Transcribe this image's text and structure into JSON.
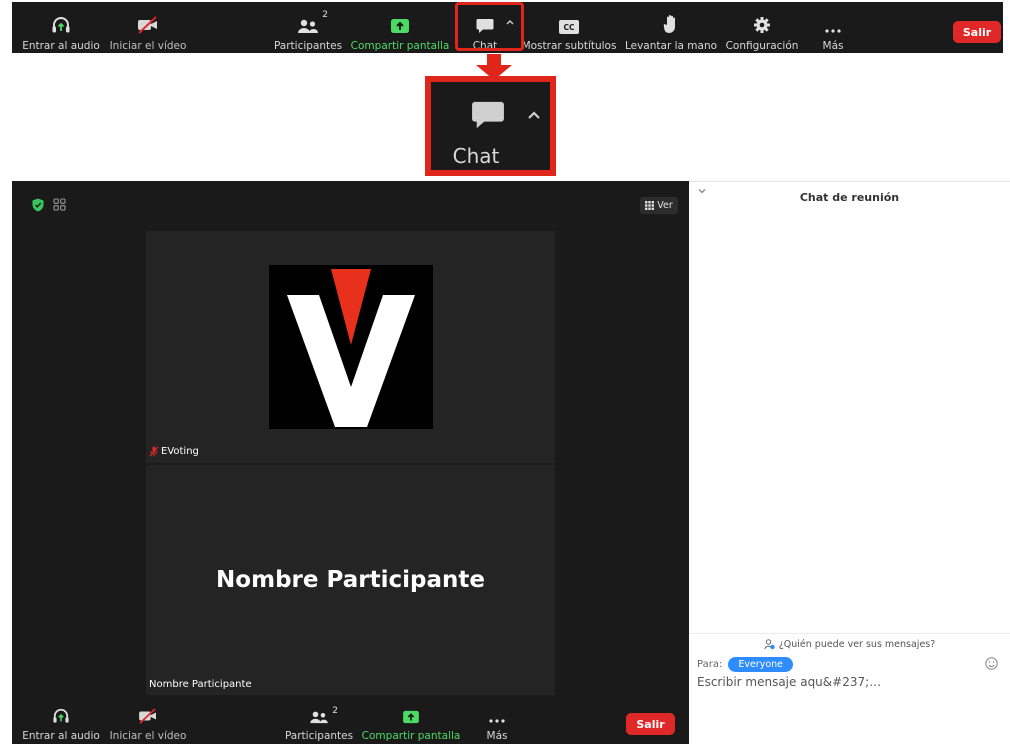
{
  "toolbar": {
    "audio_label": "Entrar al audio",
    "video_label": "Iniciar el vídeo",
    "participants_label": "Participantes",
    "participants_count": "2",
    "share_label": "Compartir pantalla",
    "chat_label": "Chat",
    "subtitles_label": "Mostrar subtítulos",
    "cc_text": "CC",
    "raise_hand_label": "Levantar la mano",
    "settings_label": "Configuración",
    "more_label": "Más",
    "leave_label": "Salir"
  },
  "zoom_callout": {
    "chat_label": "Chat"
  },
  "meeting": {
    "view_label": "Ver",
    "tile1_name": "EVoting",
    "tile2_big_name": "Nombre Participante",
    "tile2_name": "Nombre Participante",
    "bottombar": {
      "audio_label": "Entrar al audio",
      "video_label": "Iniciar el vídeo",
      "participants_label": "Participantes",
      "participants_count": "2",
      "share_label": "Compartir pantalla",
      "more_label": "Más",
      "leave_label": "Salir"
    }
  },
  "chat_panel": {
    "title": "Chat de reunión",
    "who_can_see": "¿Quién puede ver sus mensajes?",
    "to_label": "Para:",
    "recipient": "Everyone",
    "input_placeholder": "Escribir mensaje aqu&#237;…"
  },
  "colors": {
    "toolbar_bg": "#1a1a1a",
    "highlight_red": "#e0261b",
    "leave_red": "#e02828",
    "share_green": "#4cd964",
    "everyone_blue": "#2d8cff",
    "tile_bg": "#242424"
  },
  "icons": {
    "audio": "headphones-icon",
    "video": "video-off-icon",
    "participants": "participants-icon",
    "share": "share-screen-icon",
    "chat": "chat-bubble-icon",
    "subtitles": "cc-icon",
    "raise_hand": "hand-icon",
    "settings": "gear-icon",
    "more": "more-dots-icon"
  }
}
